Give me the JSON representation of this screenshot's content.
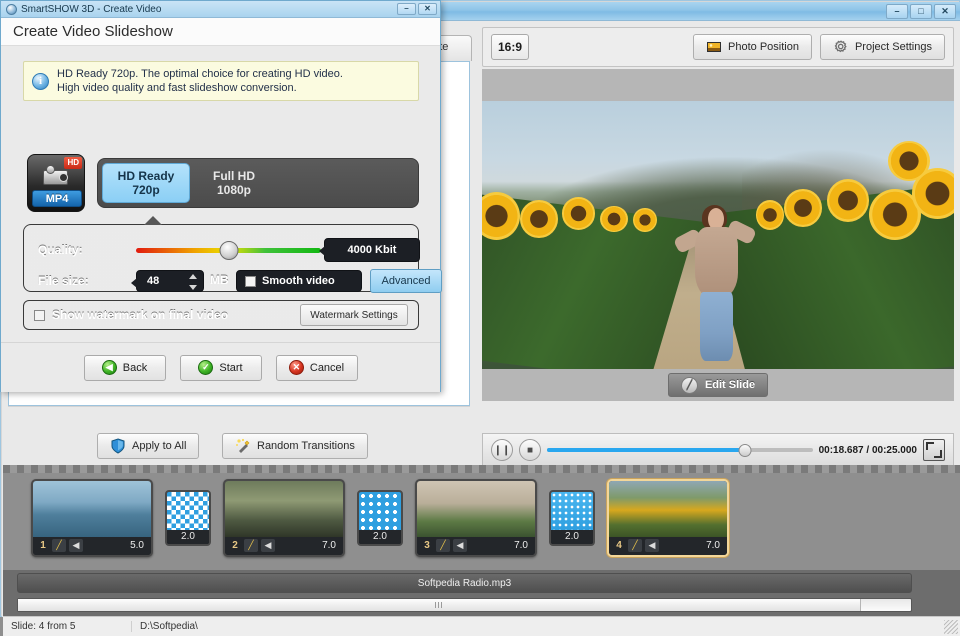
{
  "app": {
    "title": "SmartSHOW 3D",
    "window_buttons": {
      "minimize": "–",
      "maximize": "□",
      "close": "✕"
    }
  },
  "left_panel": {
    "tab_create_label": "eate",
    "apply_to_all_label": "Apply to All",
    "random_transitions_label": "Random Transitions"
  },
  "preview_toolbar": {
    "aspect_ratio": "16:9",
    "photo_position_label": "Photo Position",
    "project_settings_label": "Project Settings"
  },
  "preview": {
    "edit_slide_label": "Edit Slide"
  },
  "player": {
    "pause_glyph": "❙❙",
    "stop_glyph": "■",
    "current_time": "00:18.687",
    "total_time": "00:25.000",
    "time_display": "00:18.687 / 00:25.000",
    "progress_percent": 74.7,
    "fullscreen_label": "fullscreen"
  },
  "filmstrip": {
    "slides": [
      {
        "number": "1",
        "duration": "5.0",
        "edit_glyph": "╱",
        "sound_glyph": "◀",
        "selected": false
      },
      {
        "number": "2",
        "duration": "7.0",
        "edit_glyph": "╱",
        "sound_glyph": "◀",
        "selected": false
      },
      {
        "number": "3",
        "duration": "7.0",
        "edit_glyph": "╱",
        "sound_glyph": "◀",
        "selected": false
      },
      {
        "number": "4",
        "duration": "7.0",
        "edit_glyph": "╱",
        "sound_glyph": "◀",
        "selected": true
      }
    ],
    "transitions": [
      {
        "duration": "2.0",
        "style": "checker"
      },
      {
        "duration": "2.0",
        "style": "dots"
      },
      {
        "duration": "2.0",
        "style": "dots-fine"
      }
    ]
  },
  "music": {
    "track_name": "Softpedia Radio.mp3"
  },
  "statusbar": {
    "slide_counter": "Slide: 4 from 5",
    "path": "D:\\Softpedia\\"
  },
  "dialog": {
    "titlebar_text": "SmartSHOW 3D - Create Video",
    "window_buttons": {
      "minimize": "–",
      "close": "✕"
    },
    "heading": "Create Video Slideshow",
    "info": {
      "icon": "info-icon",
      "line1": "HD Ready 720p. The optimal choice for creating HD video.",
      "line2": "High video quality and fast slideshow conversion."
    },
    "format_icon": {
      "hd_badge": "HD",
      "container_label": "MP4"
    },
    "resolutions": [
      {
        "name": "HD Ready",
        "value": "720p",
        "active": true
      },
      {
        "name": "Full HD",
        "value": "1080p",
        "active": false
      }
    ],
    "quality": {
      "label": "Quality:",
      "bitrate": "4000 Kbit",
      "slider_percent": 50
    },
    "filesize": {
      "label": "File size:",
      "value": "48",
      "unit": "MB"
    },
    "smooth_video": {
      "label": "Smooth video",
      "checked": false
    },
    "advanced_label": "Advanced",
    "watermark": {
      "label": "Show watermark on final video",
      "checked": false,
      "settings_label": "Watermark Settings"
    },
    "footer_buttons": [
      {
        "label": "Back",
        "icon": "back-arrow-icon",
        "glyph": "◀",
        "color": "green"
      },
      {
        "label": "Start",
        "icon": "check-icon",
        "glyph": "✓",
        "color": "green"
      },
      {
        "label": "Cancel",
        "icon": "close-icon",
        "glyph": "✕",
        "color": "red"
      }
    ]
  },
  "colors": {
    "accent_blue": "#29a7ef",
    "title_blue": "#8ec4e8",
    "selected_slide": "#f3d79a",
    "panel_dark": "#535353",
    "info_bg": "#fbfbe0"
  }
}
